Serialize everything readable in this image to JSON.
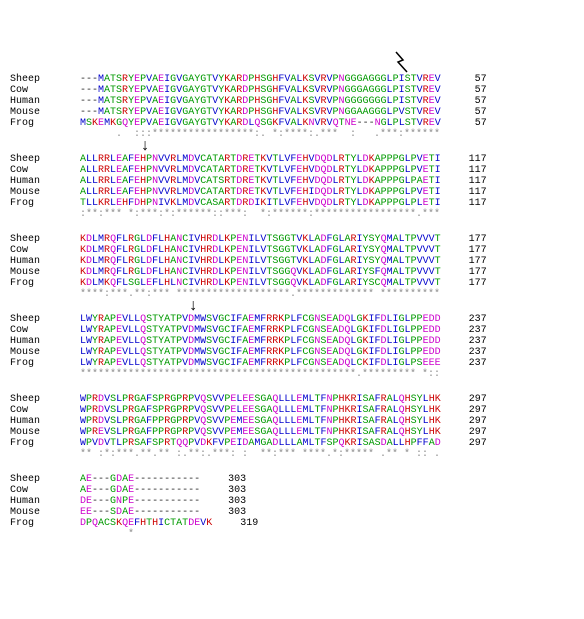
{
  "alignment": {
    "species": [
      "Sheep",
      "Cow",
      "Human",
      "Mouse",
      "Frog"
    ],
    "blocks": [
      {
        "start_gap": "---",
        "seqs": [
          "MATSRYEPVAEIGVGAYGTVYKARDPHSGHFVALKSVRVPNGGGAGGGLPISTVREV",
          "MATSRYEPVAEIGVGAYGTVYKARDPHSGHFVALKSVRVPNGGGAGGGLPISTVREV",
          "MATSRYEPVAEIGVGAYGTVYKARDPHSGHFVALKSVRVPNGGGGGGGLPISTVREV",
          "MATSRYEPVAEIGVGAYGTVYKARDPHSGHFVALKSVRVPNGGAAGGGLPVSTVREV",
          "MSKEMKGQYEPVAEIGVGAYGTVYKARDLQSGKFVALKNVRVQTNE---NGLPLSTVREV"
        ],
        "end": [
          57,
          57,
          57,
          57,
          57
        ],
        "cons": "   .  :::*****************:. *:****:.***  :   .***:******"
      },
      {
        "seqs": [
          "ALLRRLEAFEHPNVVRLMDVCATARTDRETKVTLVFEHVDQDLRTYLDKAPPPGLPVETI",
          "ALLRRLEAFEHPNVVRLMDVCATARTDRETKVTLVFEHVDQDLRTYLDKAPPPGLPVETI",
          "ALLRRLEAFEHPNVVRLMDVCATSRTDRETKVTLVFEHVDQDLRTYLDKAPPPGLPAETI",
          "ALLRRLEAFEHPNVVRLMDVCATARTDRETKVTLVFEHIDQDLRTYLDKAPPPGLPVETI",
          "TLLKRLEHFDHPNIVKLMDVCASARTDRDIKITLVFEHVDQDLRTYLDKAPPPGLPLETI"
        ],
        "end": [
          117,
          117,
          117,
          117,
          117
        ],
        "cons": ":**:*** *:***:*:******::***:  *:******:*****************.***"
      },
      {
        "seqs": [
          "KDLMRQFLRGLDFLHANCIVHRDLKPENILVTSGGTVKLADFGLARIYSYQMALTPVVVT",
          "KDLMRQFLRGLDFLHANCIVHRDLKPENILVTSGGTVKLADFGLARIYSYQMALTPVVVT",
          "KDLMRQFLRGLDFLHANCIVHRDLKPENILVTSGGTVKLADFGLARIYSYQMALTPVVVT",
          "KDLMRQFLRGLDFLHANCIVHRDLKPENILVTSGGQVKLADFGLARIYSFQMALTPVVVT",
          "KDLMKQFLSGLEFLHLNCIVHRDLKPENILVTSGGQVKLADFGLARIYSCQMALTPVVVT"
        ],
        "end": [
          177,
          177,
          177,
          177,
          177
        ],
        "cons": "****:***.**:*** *******************.************* **********"
      },
      {
        "seqs": [
          "LWYRAPEVLLQSTYATPVDMWSVGCIFAEMFRRKPLFCGNSEADQLGKIFDLIGLPPEDD",
          "LWYRAPEVLLQSTYATPVDMWSVGCIFAEMFRRKPLFCGNSEADQLGKIFDLIGLPPEDD",
          "LWYRAPEVLLQSTYATPVDMWSVGCIFAEMFRRKPLFCGNSEADQLGKIFDLIGLPPEDD",
          "LWYRAPEVLLQSTYATPVDMWSVGCIFAEMFRRKPLFCGNSEADQLGKIFDLIGLPPEDD",
          "LWYRAPEVLLQSTYATPVDMWSVGCIFAEMFRRKPLFCGNSEADQLCKIFDLIGLPSEEE"
        ],
        "end": [
          237,
          237,
          237,
          237,
          237
        ],
        "cons": "**********************************************.********* *::"
      },
      {
        "seqs": [
          "WPRDVSLPRGAFSPRGPRPVQSVVPELEESGAQLLLEMLTFNPHKRISAFRALQHSYLHK",
          "WPRDVSLPRGAFSPRGPRPVQSVVPELEESGAQLLLEMLTFNPHKRISAFRALQHSYLHK",
          "WPRDVSLPRGAFPPRGPRPVQSVVPEMEESGAQLLLEMLTFNPHKRISAFRALQHSYLHK",
          "WPREVSLPRGAFPPRGPRPVQSVVPEMEESGAQLLLEMLTFNPHKRISAFRALQHSYLHK",
          "WPVDVTLPRSAFSPRTQQPVDKFVPEIDAMGADLLLAMLTFSPQKRISASDALLHPFFAD"
        ],
        "end": [
          297,
          297,
          297,
          297,
          297
        ],
        "cons": "** :*:***.**.** :.**:.***: :  **:*** ****.*:***** .** * :: ."
      },
      {
        "seqs": [
          "AE---GDAE-----------",
          "AE---GDAE-----------",
          "DE---GNPE-----------",
          "EE---SDAE-----------",
          "DPQACSKQEFHTHICTATDEVK"
        ],
        "end": [
          303,
          303,
          303,
          303,
          319
        ],
        "cons": "        *           "
      }
    ],
    "annotations": {
      "bolt_residue_index": 50,
      "arrows_residue_index": [
        10,
        18
      ],
      "arrows_block_index": [
        1,
        3
      ]
    }
  }
}
